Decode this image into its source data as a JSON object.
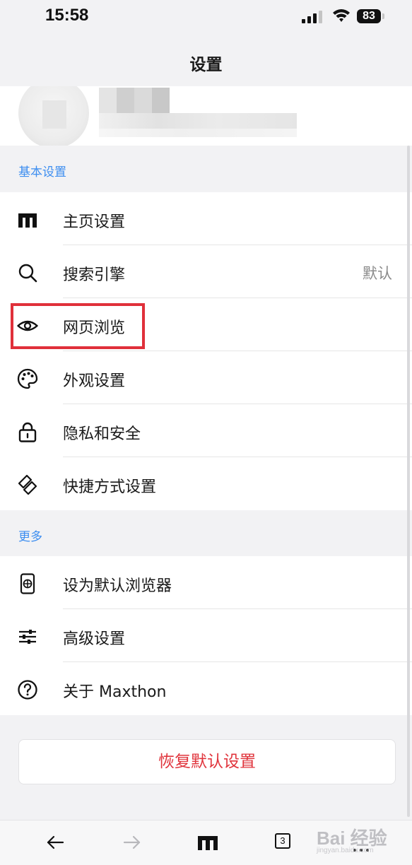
{
  "status_bar": {
    "time": "15:58",
    "battery": "83"
  },
  "nav": {
    "title": "设置"
  },
  "sections": {
    "basic": {
      "label": "基本设置",
      "items": [
        {
          "label": "主页设置",
          "icon": "maxthon-home-icon"
        },
        {
          "label": "搜索引擎",
          "icon": "search-icon",
          "value": "默认"
        },
        {
          "label": "网页浏览",
          "icon": "eye-icon"
        },
        {
          "label": "外观设置",
          "icon": "palette-icon"
        },
        {
          "label": "隐私和安全",
          "icon": "lock-icon"
        },
        {
          "label": "快捷方式设置",
          "icon": "shortcut-icon"
        }
      ]
    },
    "more": {
      "label": "更多",
      "items": [
        {
          "label": "设为默认浏览器",
          "icon": "phone-globe-icon"
        },
        {
          "label": "高级设置",
          "icon": "sliders-icon"
        },
        {
          "label": "关于 Maxthon",
          "icon": "help-icon"
        }
      ]
    }
  },
  "reset_button": {
    "label": "恢复默认设置"
  },
  "toolbar": {
    "tab_count": "3"
  },
  "watermark": {
    "main": "Bai 经验",
    "sub": "jingyan.baidu.com"
  },
  "colors": {
    "accent_blue": "#3d8ef0",
    "danger_red": "#e0343c",
    "highlight_red": "#e0303a"
  }
}
